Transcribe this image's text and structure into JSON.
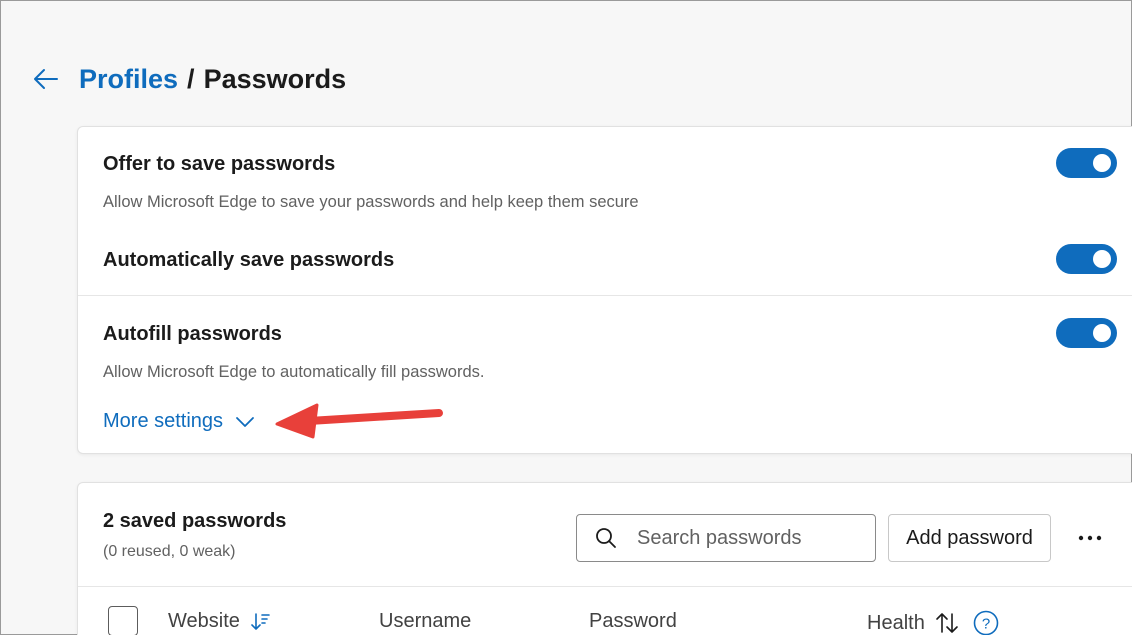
{
  "breadcrumb": {
    "parent": "Profiles",
    "separator": "/",
    "current": "Passwords"
  },
  "settings": {
    "offer_save": {
      "title": "Offer to save passwords",
      "description": "Allow Microsoft Edge to save your passwords and help keep them secure",
      "enabled": true
    },
    "auto_save": {
      "title": "Automatically save passwords",
      "enabled": true
    },
    "autofill": {
      "title": "Autofill passwords",
      "description": "Allow Microsoft Edge to automatically fill passwords.",
      "enabled": true
    },
    "more_settings_label": "More settings"
  },
  "saved": {
    "title": "2 saved passwords",
    "subtitle": "(0 reused, 0 weak)",
    "search_placeholder": "Search passwords",
    "add_label": "Add password",
    "columns": [
      "Website",
      "Username",
      "Password",
      "Health"
    ]
  },
  "colors": {
    "accent": "#0f6cbd",
    "annotation_arrow": "#e8403a"
  }
}
